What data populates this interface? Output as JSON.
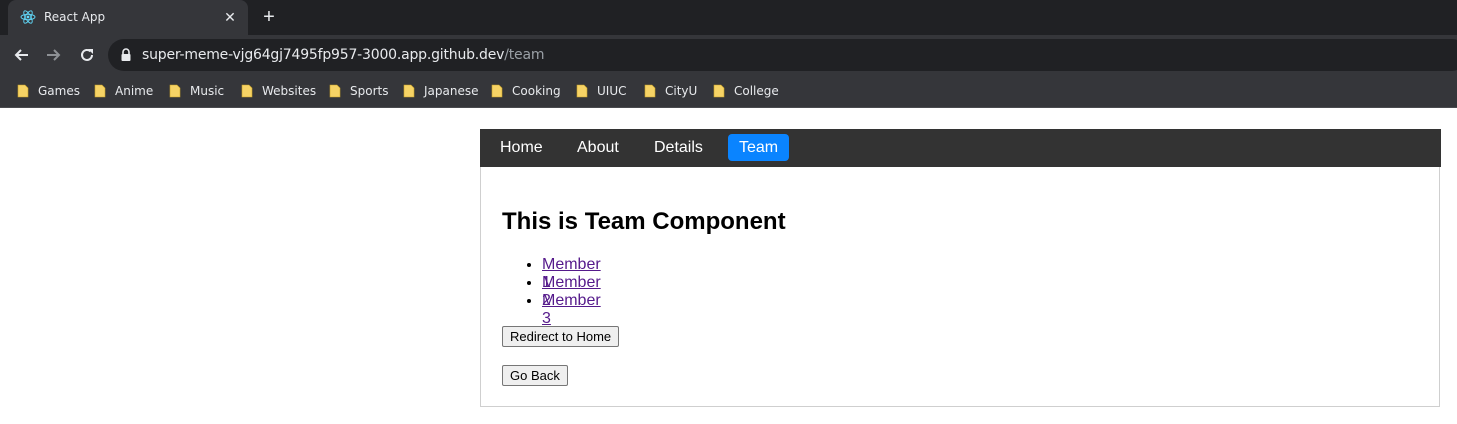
{
  "browser": {
    "tab_title": "React App",
    "url_host": "super-meme-vjg64gj7495fp957-3000.app.github.dev",
    "url_path": "/team",
    "bookmarks": [
      {
        "label": "Games"
      },
      {
        "label": "Anime"
      },
      {
        "label": "Music"
      },
      {
        "label": "Websites"
      },
      {
        "label": "Sports"
      },
      {
        "label": "Japanese"
      },
      {
        "label": "Cooking"
      },
      {
        "label": "UIUC"
      },
      {
        "label": "CityU"
      },
      {
        "label": "College"
      }
    ],
    "icons": {
      "favicon": "react-logo-icon",
      "close": "close-icon",
      "new_tab": "plus-icon",
      "back": "back-arrow-icon",
      "forward": "forward-arrow-icon",
      "reload": "reload-icon",
      "lock": "lock-icon",
      "bookmark": "folder-icon"
    }
  },
  "navbar": {
    "items": [
      {
        "label": "Home",
        "active": false
      },
      {
        "label": "About",
        "active": false
      },
      {
        "label": "Details",
        "active": false
      },
      {
        "label": "Team",
        "active": true
      }
    ],
    "active_color": "#0a84ff",
    "background": "#333333"
  },
  "team": {
    "heading": "This is Team Component",
    "members": [
      {
        "label": "Member 1"
      },
      {
        "label": "Member 2"
      },
      {
        "label": "Member 3"
      }
    ],
    "redirect_button": "Redirect to Home",
    "back_button": "Go Back"
  }
}
